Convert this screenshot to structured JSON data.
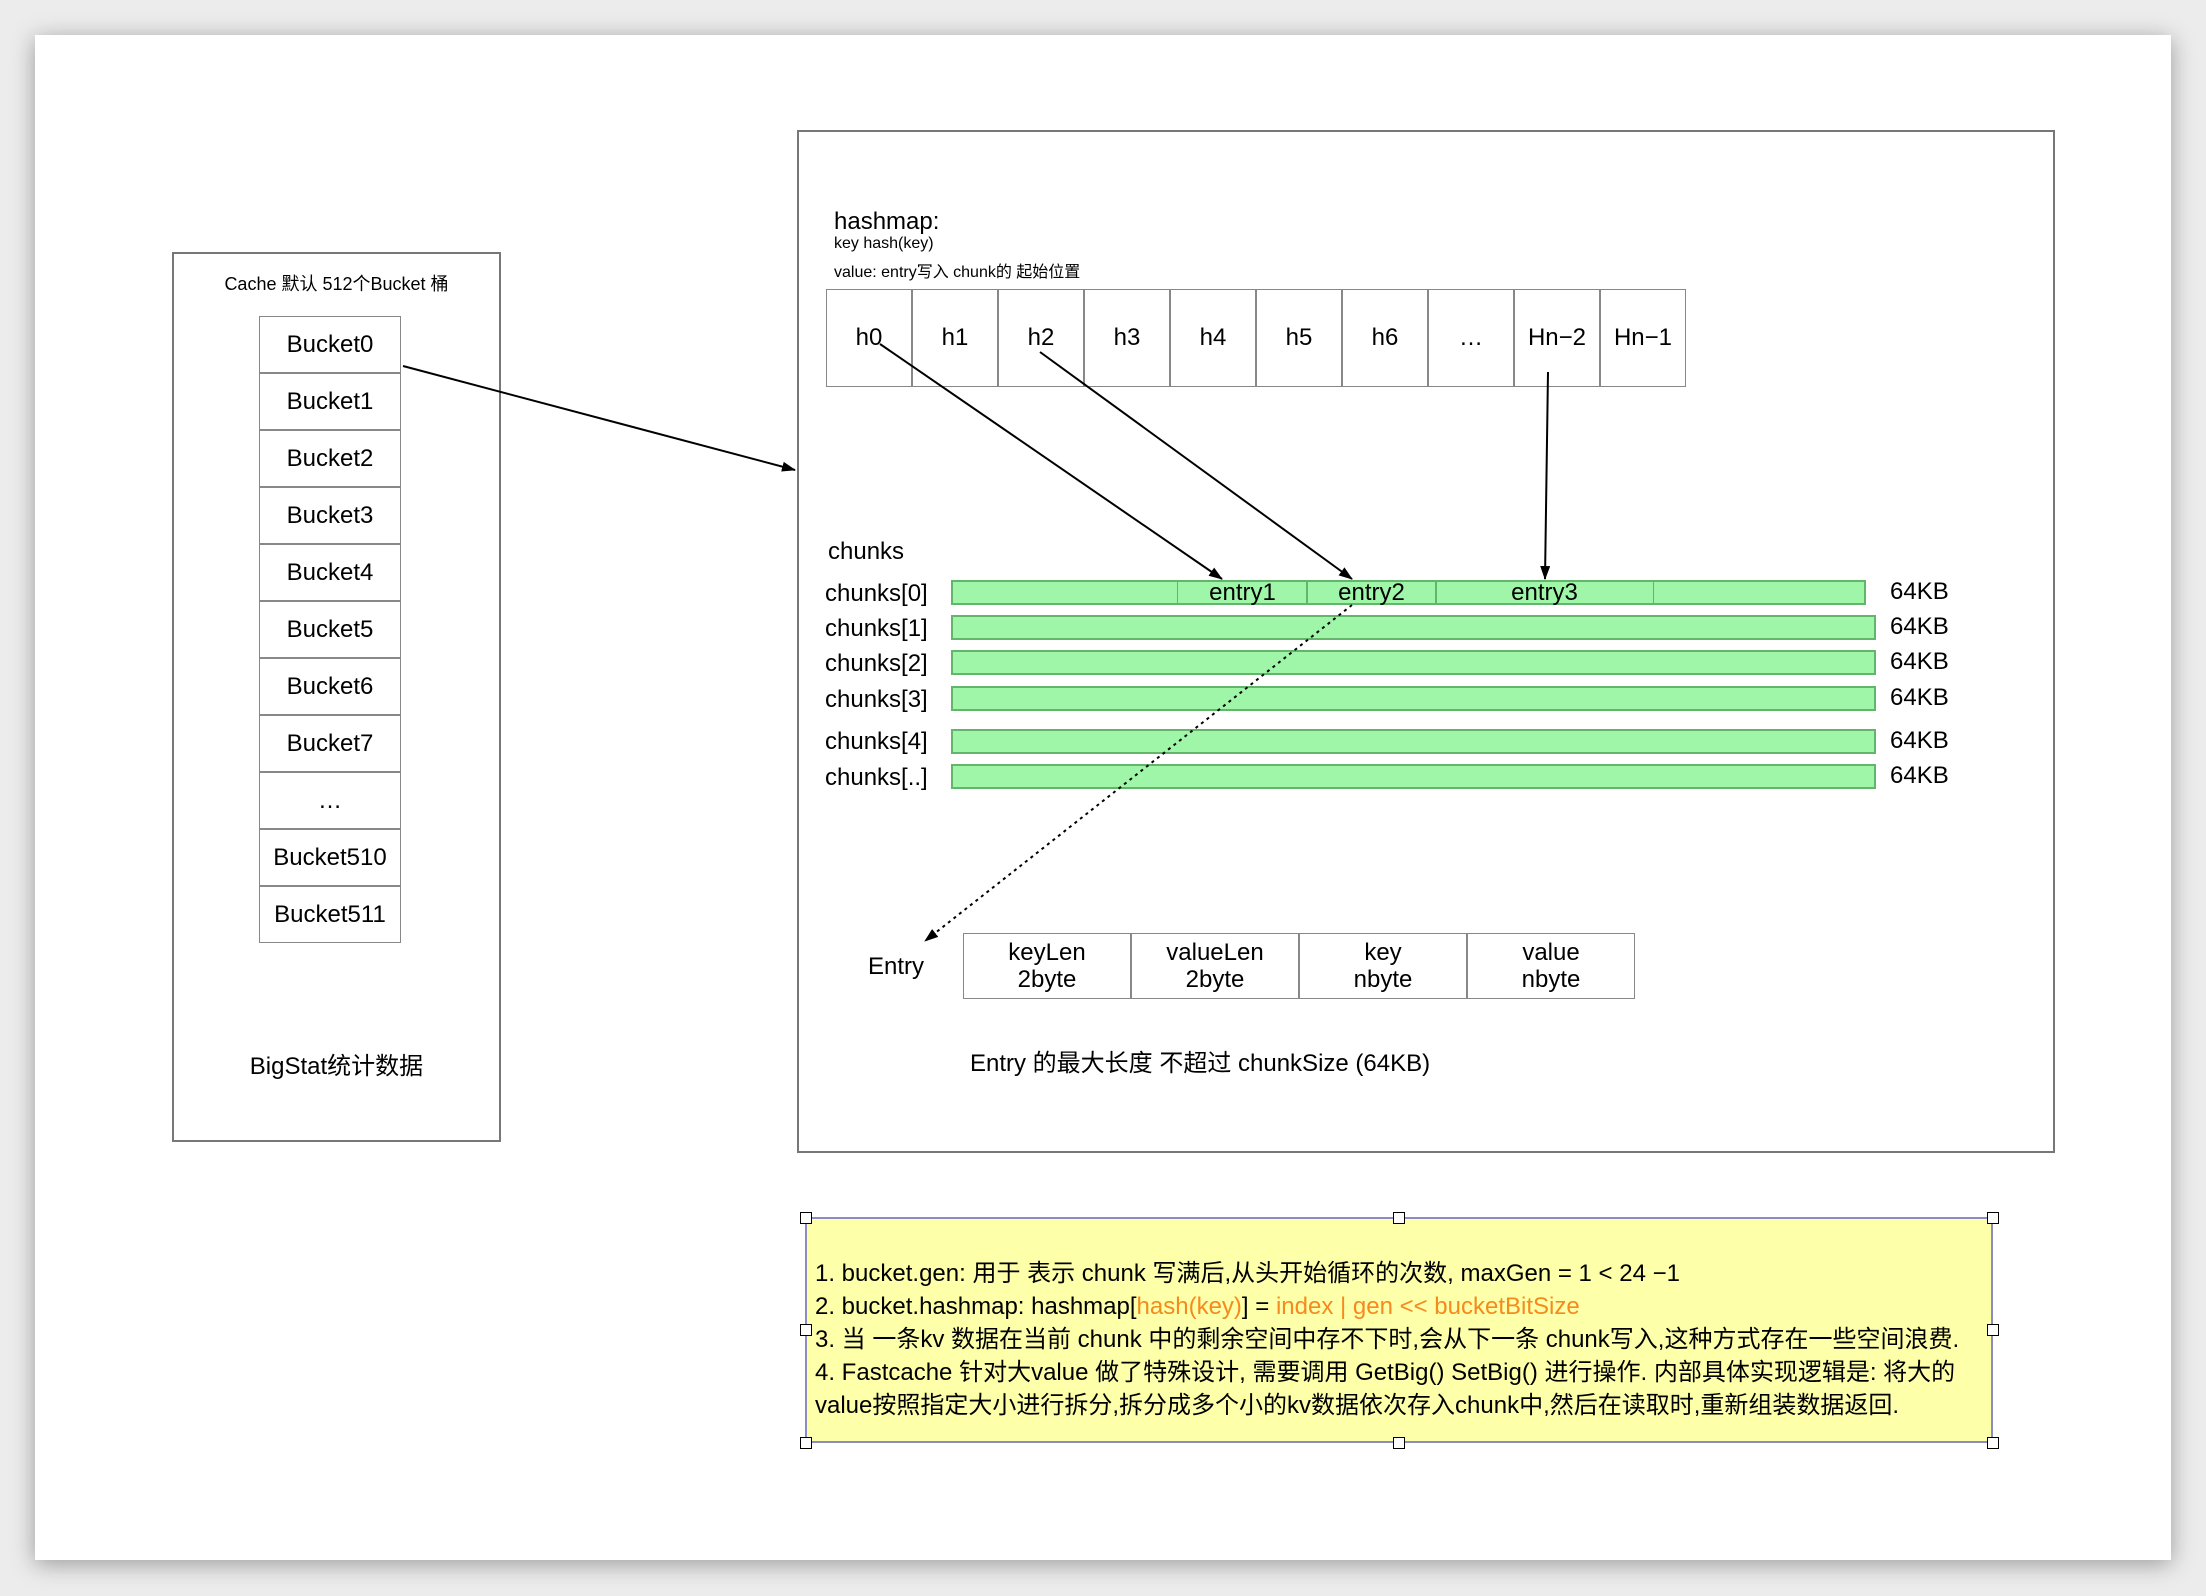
{
  "cache": {
    "title": "Cache 默认 512个Bucket 桶",
    "buckets": [
      "Bucket0",
      "Bucket1",
      "Bucket2",
      "Bucket3",
      "Bucket4",
      "Bucket5",
      "Bucket6",
      "Bucket7",
      "…",
      "Bucket510",
      "Bucket511"
    ],
    "stats_label": "BigStat统计数据"
  },
  "hashmap": {
    "title": "hashmap:",
    "key_desc": "key hash(key)",
    "value_desc": "value:  entry写入 chunk的 起始位置",
    "cells": [
      "h0",
      "h1",
      "h2",
      "h3",
      "h4",
      "h5",
      "h6",
      "…",
      "Hn−2",
      "Hn−1"
    ]
  },
  "chunks": {
    "title": "chunks",
    "rows": [
      {
        "label": "chunks[0]",
        "size": "64KB"
      },
      {
        "label": "chunks[1]",
        "size": "64KB"
      },
      {
        "label": "chunks[2]",
        "size": "64KB"
      },
      {
        "label": "chunks[3]",
        "size": "64KB"
      },
      {
        "label": "chunks[4]",
        "size": "64KB"
      },
      {
        "label": "chunks[..]",
        "size": "64KB"
      }
    ],
    "entries": [
      "entry1",
      "entry2",
      "entry3"
    ],
    "bar_color": "#9ff5a8",
    "bar_border_color": "#63b56b"
  },
  "entry": {
    "label": "Entry",
    "fields": [
      {
        "name": "keyLen",
        "size": "2byte"
      },
      {
        "name": "valueLen",
        "size": "2byte"
      },
      {
        "name": "key",
        "size": "nbyte"
      },
      {
        "name": "value",
        "size": "nbyte"
      }
    ],
    "max_note": "Entry 的最大长度 不超过  chunkSize (64KB)"
  },
  "notes": {
    "line1": "1. bucket.gen: 用于 表示  chunk 写满后,从头开始循环的次数, maxGen = 1 < 24 −1",
    "line2_prefix": "2. bucket.hashmap:   hashmap[",
    "line2_hash": "hash(key)",
    "line2_mid": "] =  ",
    "line2_value": "index | gen << bucketBitSize",
    "line3": "3. 当 一条kv 数据在当前 chunk 中的剩余空间中存不下时,会从下一条 chunk写入,这种方式存在一些空间浪费.",
    "line4": "4. Fastcache 针对大value 做了特殊设计, 需要调用   GetBig() SetBig() 进行操作. 内部具体实现逻辑是: 将大的",
    "line5": "value按照指定大小进行拆分,拆分成多个小的kv数据依次存入chunk中,然后在读取时,重新组装数据返回.",
    "background_color": "#fdffa9",
    "highlight_color": "#f58a1f"
  }
}
